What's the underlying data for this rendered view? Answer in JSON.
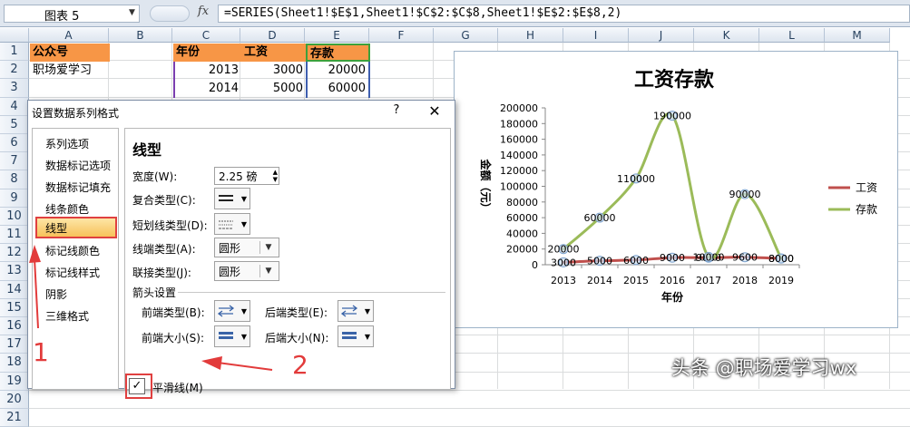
{
  "formula_bar": {
    "name_box": "图表 5",
    "fx_label": "fx",
    "formula": "=SERIES(Sheet1!$E$1,Sheet1!$C$2:$C$8,Sheet1!$E$2:$E$8,2)"
  },
  "sheet": {
    "columns": [
      "A",
      "B",
      "C",
      "D",
      "E",
      "F",
      "G",
      "H",
      "I",
      "J",
      "K",
      "L",
      "M"
    ],
    "rows": [
      "1",
      "2",
      "3",
      "4",
      "5",
      "6",
      "7",
      "8",
      "9",
      "10",
      "11",
      "12",
      "13",
      "14",
      "15",
      "16",
      "17",
      "18",
      "19",
      "20",
      "21"
    ],
    "a1": "公众号",
    "a2": "职场爱学习",
    "header": {
      "c": "年份",
      "d": "工资",
      "e": "存款"
    },
    "data_rows": [
      {
        "c": "2013",
        "d": "3000",
        "e": "20000"
      },
      {
        "c": "2014",
        "d": "5000",
        "e": "60000"
      }
    ]
  },
  "dialog": {
    "title": "设置数据系列格式",
    "help": "?",
    "close": "✕",
    "nav_items": [
      "系列选项",
      "数据标记选项",
      "数据标记填充",
      "线条颜色",
      "线型",
      "标记线颜色",
      "标记线样式",
      "阴影",
      "三维格式"
    ],
    "selected_nav": "线型",
    "section_title": "线型",
    "width_label": "宽度(W):",
    "width_value": "2.25 磅",
    "compound_label": "复合类型(C):",
    "dash_label": "短划线类型(D):",
    "cap_label": "线端类型(A):",
    "cap_value": "圆形",
    "join_label": "联接类型(J):",
    "join_value": "圆形",
    "arrow_section": "箭头设置",
    "begin_type_label": "前端类型(B):",
    "end_type_label": "后端类型(E):",
    "begin_size_label": "前端大小(S):",
    "end_size_label": "后端大小(N):",
    "smooth_label": "平滑线(M)",
    "smooth_checked": "✓"
  },
  "chart_data": {
    "type": "line",
    "title": "工资存款",
    "xlabel": "年份",
    "ylabel": "金额（元）",
    "categories": [
      "2013",
      "2014",
      "2015",
      "2016",
      "2017",
      "2018",
      "2019"
    ],
    "ylim": [
      0,
      200000
    ],
    "yticks": [
      "0",
      "20000",
      "40000",
      "60000",
      "80000",
      "100000",
      "120000",
      "140000",
      "160000",
      "180000",
      "200000"
    ],
    "series": [
      {
        "name": "工资",
        "values": [
          3000,
          5000,
          6000,
          9000,
          9000,
          9600,
          8000
        ],
        "labels": [
          "3000",
          "5000",
          "6000",
          "9000",
          "9000",
          "9600",
          "8000"
        ],
        "color": "#c0504d"
      },
      {
        "name": "存款",
        "values": [
          20000,
          60000,
          110000,
          190000,
          10000,
          90000,
          8000
        ],
        "labels": [
          "20000",
          "60000",
          "110000",
          "190000",
          "10000",
          "90000",
          "8000"
        ],
        "color": "#9bbb59"
      }
    ],
    "legend_position": "right"
  },
  "annotations": {
    "step1": "1",
    "step2": "2",
    "arrow_color": "#e23b3b"
  },
  "watermark": "头条 @职场爱学习wx"
}
